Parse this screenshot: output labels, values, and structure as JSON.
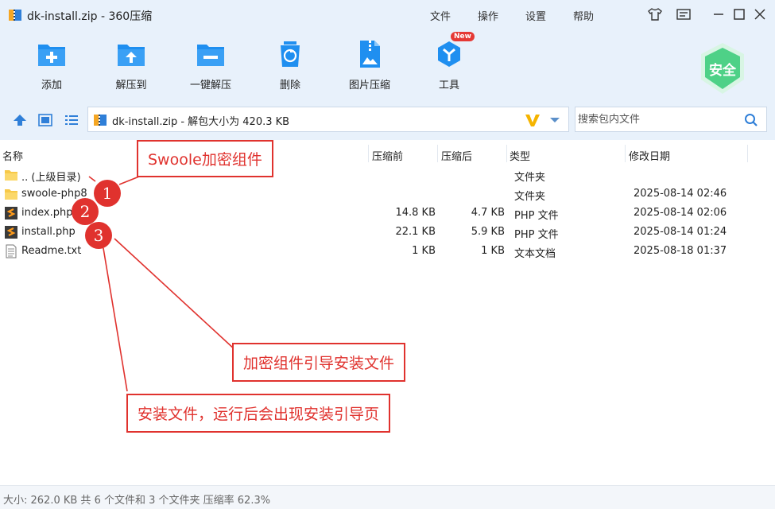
{
  "window": {
    "title": "dk-install.zip - 360压缩",
    "menu": [
      "文件",
      "操作",
      "设置",
      "帮助"
    ]
  },
  "toolbar": {
    "items": [
      {
        "label": "添加",
        "icon": "add-archive-icon"
      },
      {
        "label": "解压到",
        "icon": "extract-to-icon"
      },
      {
        "label": "一键解压",
        "icon": "one-click-extract-icon"
      },
      {
        "label": "删除",
        "icon": "delete-icon"
      },
      {
        "label": "图片压缩",
        "icon": "image-compress-icon"
      },
      {
        "label": "工具",
        "icon": "tools-icon",
        "badge": "New"
      }
    ],
    "safe_label": "安全"
  },
  "address": {
    "path": "dk-install.zip - 解包大小为 420.3 KB",
    "search_placeholder": "搜索包内文件"
  },
  "list": {
    "columns": {
      "name": "名称",
      "packed": "压缩前",
      "size": "压缩后",
      "type": "类型",
      "modified": "修改日期"
    },
    "rows": [
      {
        "name": ".. (上级目录)",
        "packed": "",
        "size": "",
        "type": "文件夹",
        "modified": "",
        "icon": "folder-icon"
      },
      {
        "name": "swoole-php8",
        "packed": "",
        "size": "",
        "type": "文件夹",
        "modified": "2025-08-14 02:46",
        "icon": "folder-icon"
      },
      {
        "name": "index.php",
        "packed": "14.8 KB",
        "size": "4.7 KB",
        "type": "PHP 文件",
        "modified": "2025-08-14 02:06",
        "icon": "php-file-icon"
      },
      {
        "name": "install.php",
        "packed": "22.1 KB",
        "size": "5.9 KB",
        "type": "PHP 文件",
        "modified": "2025-08-14 01:24",
        "icon": "php-file-icon"
      },
      {
        "name": "Readme.txt",
        "packed": "1 KB",
        "size": "1 KB",
        "type": "文本文档",
        "modified": "2025-08-18 01:37",
        "icon": "text-file-icon"
      }
    ]
  },
  "status": {
    "text": "大小: 262.0 KB 共 6 个文件和 3 个文件夹 压缩率 62.3%"
  },
  "annotations": {
    "callout_1": "Swoole加密组件",
    "callout_2": "加密组件引导安装文件",
    "callout_3": "安装文件，运行后会出现安装引导页",
    "markers": [
      "1",
      "2",
      "3"
    ],
    "color": "#e0322e"
  },
  "colors": {
    "toolbar_bg": "#e8f1fb",
    "icon_blue": "#1f8ff0",
    "safe_green": "#4ed187"
  }
}
